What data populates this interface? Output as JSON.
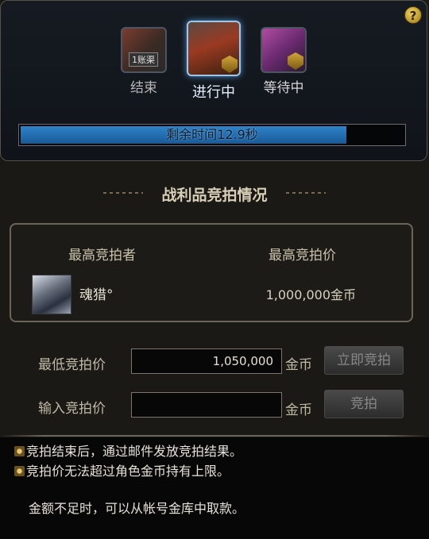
{
  "help": {
    "label": "?"
  },
  "stages": [
    {
      "label": "结束",
      "stamp": "1账渠",
      "icon": "treasure-chest-icon"
    },
    {
      "label": "进行中",
      "icon": "crate-icon"
    },
    {
      "label": "等待中",
      "icon": "crystal-icon"
    }
  ],
  "timer": {
    "text": "剩余时间12.9秒",
    "progress": 0.85
  },
  "section_title": "战利品竞拍情况",
  "highest_bid": {
    "bidder_header": "最高竞拍者",
    "price_header": "最高竞拍价",
    "bidder_name": "魂猎°",
    "price": "1,000,000金币"
  },
  "form": {
    "min_label": "最低竞拍价",
    "min_value": "1,050,000",
    "input_label": "输入竞拍价",
    "input_value": "",
    "unit": "金币",
    "instant_button": "立即竞拍",
    "bid_button": "竞拍"
  },
  "notes": [
    "竞拍结束后，通过邮件发放竞拍结果。",
    "竞拍价无法超过角色金币持有上限。",
    "金额不足时，可以从帐号金库中取款。"
  ],
  "colors": {
    "accent": "#2f82c8",
    "panel": "#1b1915",
    "gold": "#d2a63a"
  }
}
